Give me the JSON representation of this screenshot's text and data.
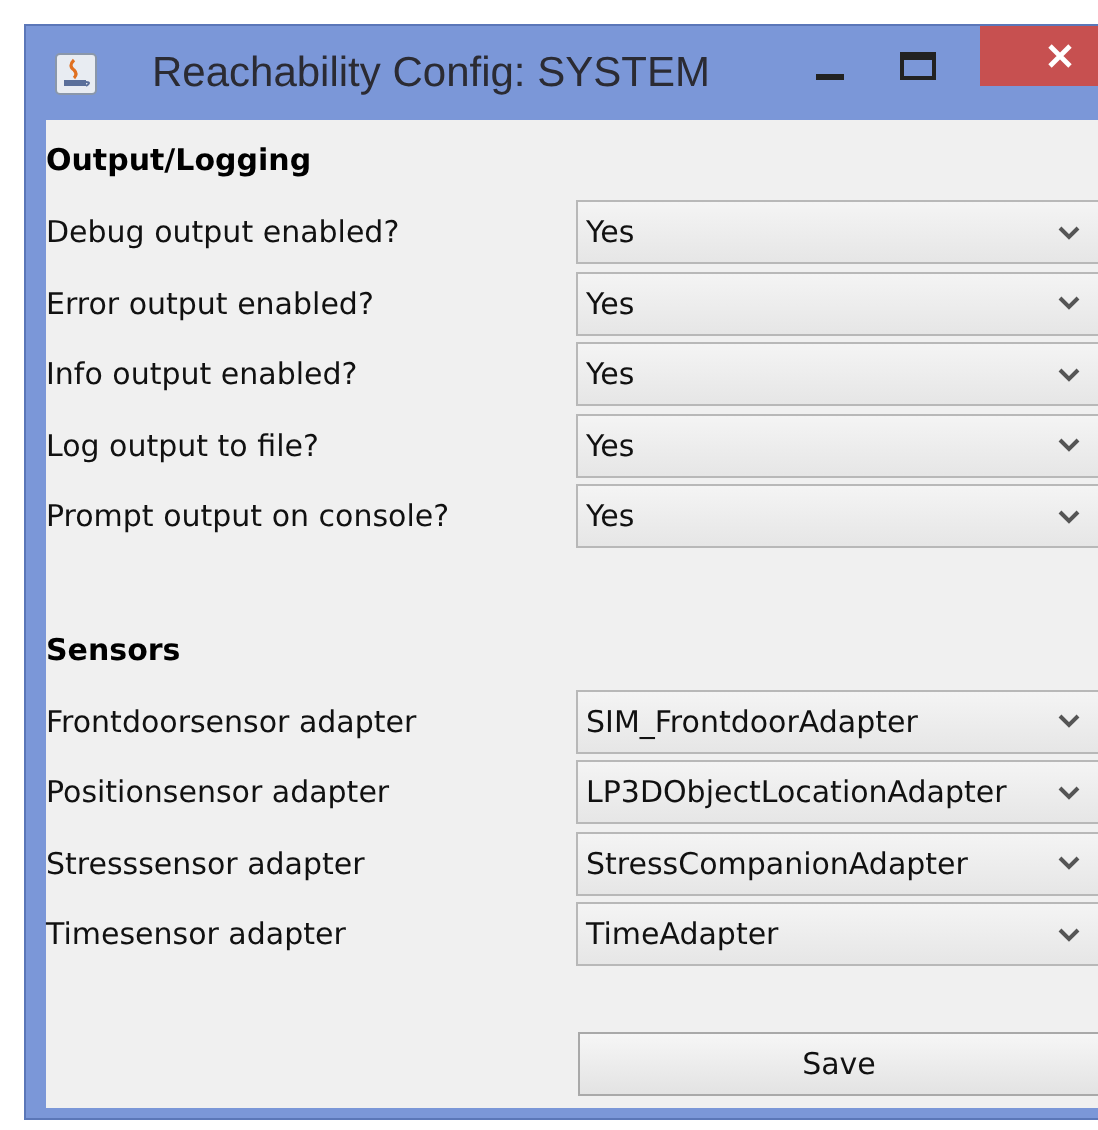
{
  "window": {
    "title": "Reachability Config: SYSTEM"
  },
  "sections": [
    {
      "title": "Output/Logging",
      "rows": [
        {
          "label": "Debug output enabled?",
          "value": "Yes"
        },
        {
          "label": "Error output enabled?",
          "value": "Yes"
        },
        {
          "label": "Info output enabled?",
          "value": "Yes"
        },
        {
          "label": "Log output to file?",
          "value": "Yes"
        },
        {
          "label": "Prompt output on console?",
          "value": "Yes"
        }
      ]
    },
    {
      "title": "Sensors",
      "rows": [
        {
          "label": "Frontdoorsensor adapter",
          "value": "SIM_FrontdoorAdapter"
        },
        {
          "label": "Positionsensor adapter",
          "value": "LP3DObjectLocationAdapter"
        },
        {
          "label": "Stresssensor adapter",
          "value": "StressCompanionAdapter"
        },
        {
          "label": "Timesensor adapter",
          "value": "TimeAdapter"
        }
      ]
    }
  ],
  "save_button": "Save"
}
